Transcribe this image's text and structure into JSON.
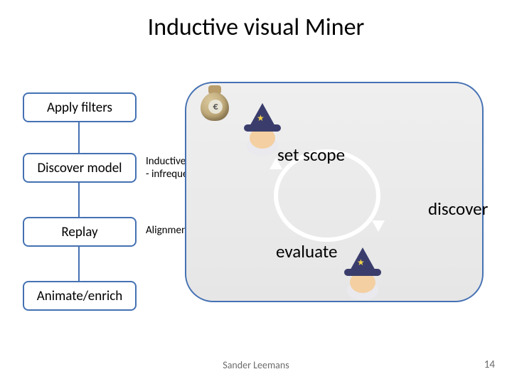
{
  "title": "Inductive visual Miner",
  "stages": {
    "apply_filters": "Apply filters",
    "discover_model": "Discover model",
    "replay": "Replay",
    "animate_enrich": "Animate/enrich"
  },
  "sublabels": {
    "discover_model": "Inductive Miner\n- infrequent",
    "replay": "Alignments"
  },
  "cycle": {
    "set_scope": "set scope",
    "discover": "discover",
    "evaluate": "evaluate"
  },
  "icons": {
    "moneybag_symbol": "€"
  },
  "footer": {
    "author": "Sander Leemans",
    "slide_number": "14"
  }
}
